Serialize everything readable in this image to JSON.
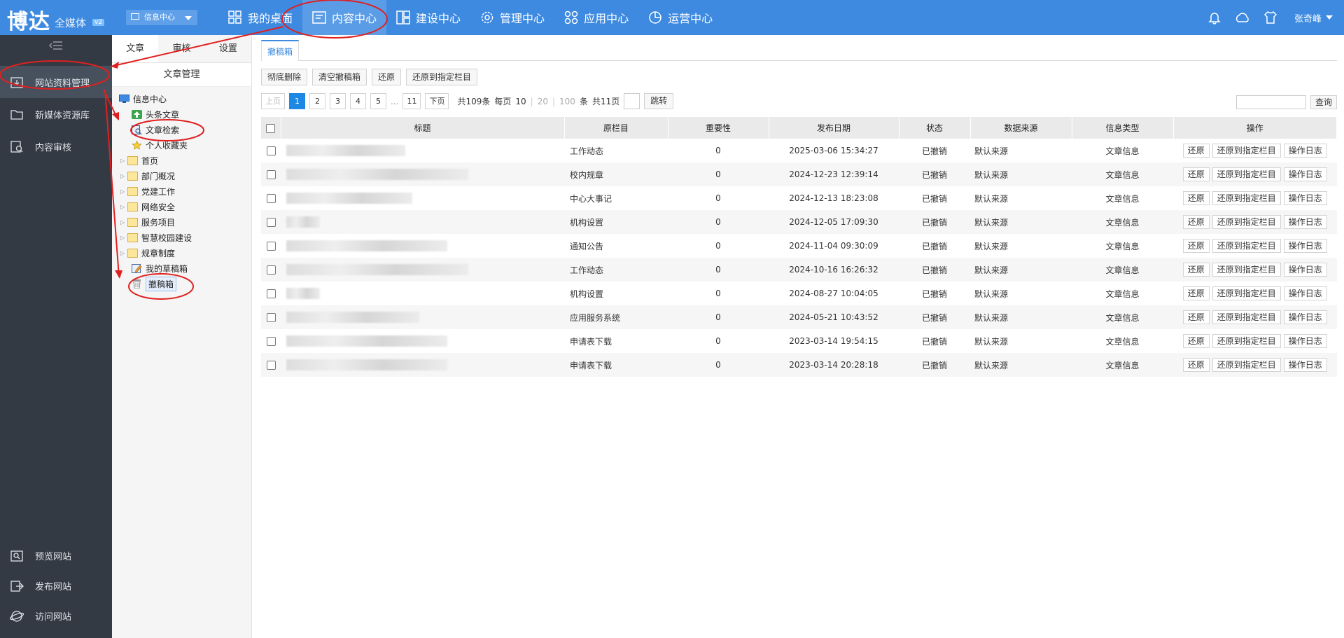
{
  "header": {
    "logo": "博达",
    "logo_sub": "全媒体",
    "logo_ver": "v2",
    "site_select": "信息中心",
    "nav": [
      {
        "label": "我的桌面",
        "icon": "desktop-icon"
      },
      {
        "label": "内容中心",
        "icon": "content-icon",
        "active": true
      },
      {
        "label": "建设中心",
        "icon": "build-icon"
      },
      {
        "label": "管理中心",
        "icon": "gear-icon"
      },
      {
        "label": "应用中心",
        "icon": "apps-icon"
      },
      {
        "label": "运营中心",
        "icon": "pie-chart-icon"
      }
    ],
    "user": "张奇峰"
  },
  "sidebar": {
    "items": [
      {
        "label": "网站资料管理",
        "icon": "archive-icon",
        "active": true
      },
      {
        "label": "新媒体资源库",
        "icon": "folder-icon"
      },
      {
        "label": "内容审核",
        "icon": "review-icon"
      }
    ],
    "bottom": [
      {
        "label": "预览网站",
        "icon": "preview-icon"
      },
      {
        "label": "发布网站",
        "icon": "publish-icon"
      },
      {
        "label": "访问网站",
        "icon": "globe-icon"
      }
    ]
  },
  "tree_panel": {
    "tabs": [
      "文章",
      "审核",
      "设置"
    ],
    "title": "文章管理",
    "root": "信息中心",
    "nodes": [
      {
        "label": "头条文章",
        "type": "special"
      },
      {
        "label": "文章检索",
        "type": "search"
      },
      {
        "label": "个人收藏夹",
        "type": "star"
      },
      {
        "label": "首页",
        "type": "folder"
      },
      {
        "label": "部门概况",
        "type": "folder"
      },
      {
        "label": "党建工作",
        "type": "folder"
      },
      {
        "label": "网络安全",
        "type": "folder"
      },
      {
        "label": "服务项目",
        "type": "folder"
      },
      {
        "label": "智慧校园建设",
        "type": "folder"
      },
      {
        "label": "规章制度",
        "type": "folder"
      },
      {
        "label": "我的草稿箱",
        "type": "draft"
      },
      {
        "label": "撤稿箱",
        "type": "trash",
        "selected": true
      }
    ]
  },
  "main": {
    "tab": "撤稿箱",
    "toolbar": [
      "彻底删除",
      "清空撤稿箱",
      "还原",
      "还原到指定栏目"
    ],
    "pager": {
      "prev": "上页",
      "pages": [
        "1",
        "2",
        "3",
        "4",
        "5"
      ],
      "ellipsis": "...",
      "last": "11",
      "next": "下页",
      "total": "共109条",
      "per_page_label": "每页",
      "sizes": [
        "10",
        "20",
        "100"
      ],
      "unit": "条",
      "total_pages": "共11页",
      "jump": "跳转"
    },
    "search_button": "查询",
    "columns": [
      "标题",
      "原栏目",
      "重要性",
      "发布日期",
      "状态",
      "数据来源",
      "信息类型",
      "操作"
    ],
    "row_actions": [
      "还原",
      "还原到指定栏目",
      "操作日志"
    ],
    "rows": [
      {
        "column": "工作动态",
        "importance": "0",
        "date": "2025-03-06 15:34:27",
        "status": "已撤销",
        "source": "默认来源",
        "type": "文章信息"
      },
      {
        "column": "校内规章",
        "importance": "0",
        "date": "2024-12-23 12:39:14",
        "status": "已撤销",
        "source": "默认来源",
        "type": "文章信息"
      },
      {
        "column": "中心大事记",
        "importance": "0",
        "date": "2024-12-13 18:23:08",
        "status": "已撤销",
        "source": "默认来源",
        "type": "文章信息"
      },
      {
        "column": "机构设置",
        "importance": "0",
        "date": "2024-12-05 17:09:30",
        "status": "已撤销",
        "source": "默认来源",
        "type": "文章信息"
      },
      {
        "column": "通知公告",
        "importance": "0",
        "date": "2024-11-04 09:30:09",
        "status": "已撤销",
        "source": "默认来源",
        "type": "文章信息"
      },
      {
        "column": "工作动态",
        "importance": "0",
        "date": "2024-10-16 16:26:32",
        "status": "已撤销",
        "source": "默认来源",
        "type": "文章信息"
      },
      {
        "column": "机构设置",
        "importance": "0",
        "date": "2024-08-27 10:04:05",
        "status": "已撤销",
        "source": "默认来源",
        "type": "文章信息"
      },
      {
        "column": "应用服务系统",
        "importance": "0",
        "date": "2024-05-21 10:43:52",
        "status": "已撤销",
        "source": "默认来源",
        "type": "文章信息"
      },
      {
        "column": "申请表下载",
        "importance": "0",
        "date": "2023-03-14 19:54:15",
        "status": "已撤销",
        "source": "默认来源",
        "type": "文章信息"
      },
      {
        "column": "申请表下载",
        "importance": "0",
        "date": "2023-03-14 20:28:18",
        "status": "已撤销",
        "source": "默认来源",
        "type": "文章信息"
      }
    ]
  },
  "colors": {
    "header_bg": "#3d8ae0",
    "sidebar_bg": "#343a44",
    "annotation": "#e02020",
    "page_active": "#1e88e5"
  }
}
